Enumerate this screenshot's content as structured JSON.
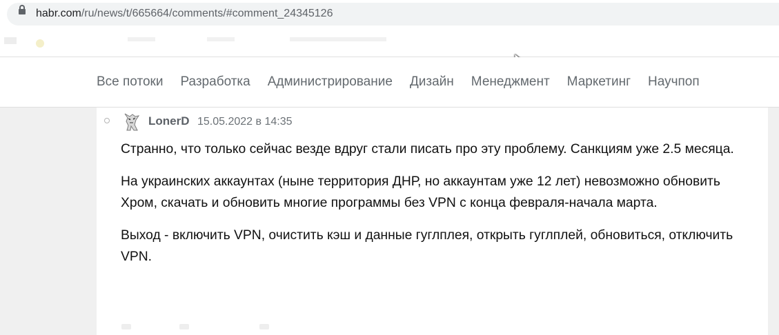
{
  "browser": {
    "url_host": "habr.com",
    "url_path": "/ru/news/t/665664/comments/#comment_24345126"
  },
  "nav": {
    "items": [
      "Все потоки",
      "Разработка",
      "Администрирование",
      "Дизайн",
      "Менеджмент",
      "Маркетинг",
      "Научпоп"
    ]
  },
  "comment": {
    "author": "LonerD",
    "date": "15.05.2022 в 14:35",
    "paragraphs": [
      "Странно, что только сейчас везде вдруг стали писать про эту проблему. Санкциям уже 2.5 месяца.",
      "На украинских аккаунтах (ныне территория ДНР, но аккаунтам уже 12 лет) невозможно обновить Хром, скачать и обновить многие программы без VPN с конца февраля-начала марта.",
      "Выход - включить VPN, очистить кэш и данные гуглплея, открыть гуглплей, обновиться, отключить VPN."
    ]
  },
  "colors": {
    "nav_text": "#63696e",
    "author_text": "#5c6167",
    "body_text": "#111111",
    "page_bg": "#f0f0f0"
  },
  "icons": {
    "lock": "lock-icon",
    "avatar": "avatar",
    "thread": "thread-marker-icon",
    "cursor": "mouse-cursor-icon"
  }
}
